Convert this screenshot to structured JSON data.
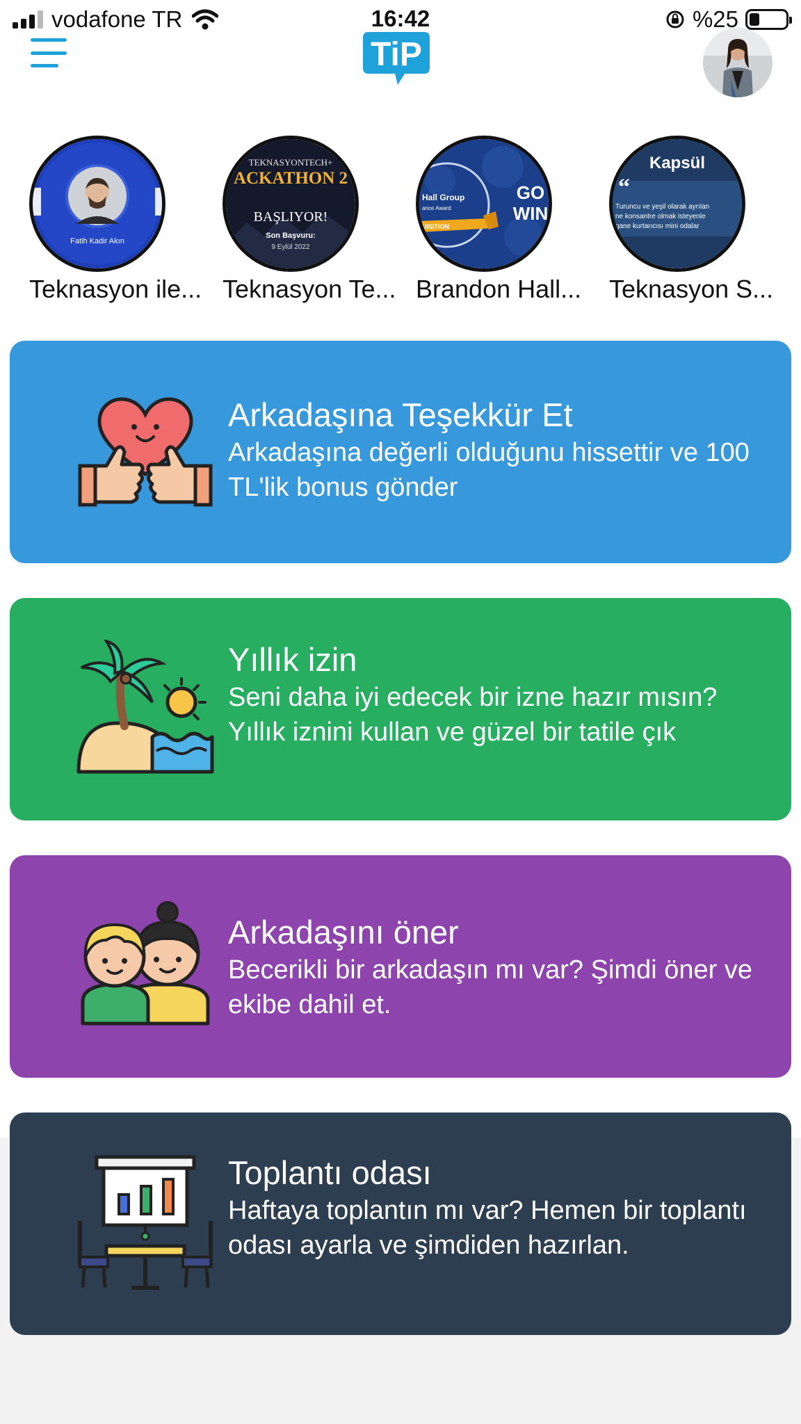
{
  "status_bar": {
    "carrier": "vodafone TR",
    "time": "16:42",
    "battery": "%25",
    "battery_level": 0.25
  },
  "header": {
    "menu_icon": "hamburger-icon",
    "logo_text": "TiP",
    "logo_color": "#1ea2d9"
  },
  "stories": [
    {
      "label": "Teknasyon ile...",
      "image_caption": "Fatih Kadir Akın"
    },
    {
      "label": "Teknasyon Te...",
      "image_lines": [
        "TEKNASYONTECH+",
        "ACKATHON 2",
        "BAŞLIYOR!",
        "Son Başvuru:",
        "9 Eylül 2022"
      ]
    },
    {
      "label": "Brandon Hall...",
      "image_lines": [
        "Hall Group",
        "ance Award",
        "UISITION",
        "GO",
        "WIN"
      ]
    },
    {
      "label": "Teknasyon S...",
      "image_lines": [
        "Kapsül",
        "Turuncu ve yeşil olarak ayrılan",
        "ne konsantre olmak isteyenle",
        "gane kurtarıcısı mini odalar"
      ]
    }
  ],
  "cards": [
    {
      "title": "Arkadaşına Teşekkür Et",
      "description": "Arkadaşına değerli olduğunu hissettir ve 100 TL'lik bonus gönder",
      "color": "#3898dc",
      "icon": "heart-thumbs-up-icon"
    },
    {
      "title": "Yıllık izin",
      "description": "Seni daha iyi edecek bir izne hazır mısın? Yıllık iznini kullan ve güzel bir tatile çık",
      "color": "#27ae60",
      "icon": "beach-palm-icon"
    },
    {
      "title": "Arkadaşını öner",
      "description": "Becerikli bir arkadaşın mı var? Şimdi öner ve ekibe dahil et.",
      "color": "#8e44ad",
      "icon": "friends-icon"
    },
    {
      "title": "Toplantı odası",
      "description": "Haftaya toplantın mı var? Hemen bir toplantı odası ayarla ve şimdiden hazırlan.",
      "color": "#2c3e50",
      "icon": "meeting-room-icon"
    }
  ]
}
